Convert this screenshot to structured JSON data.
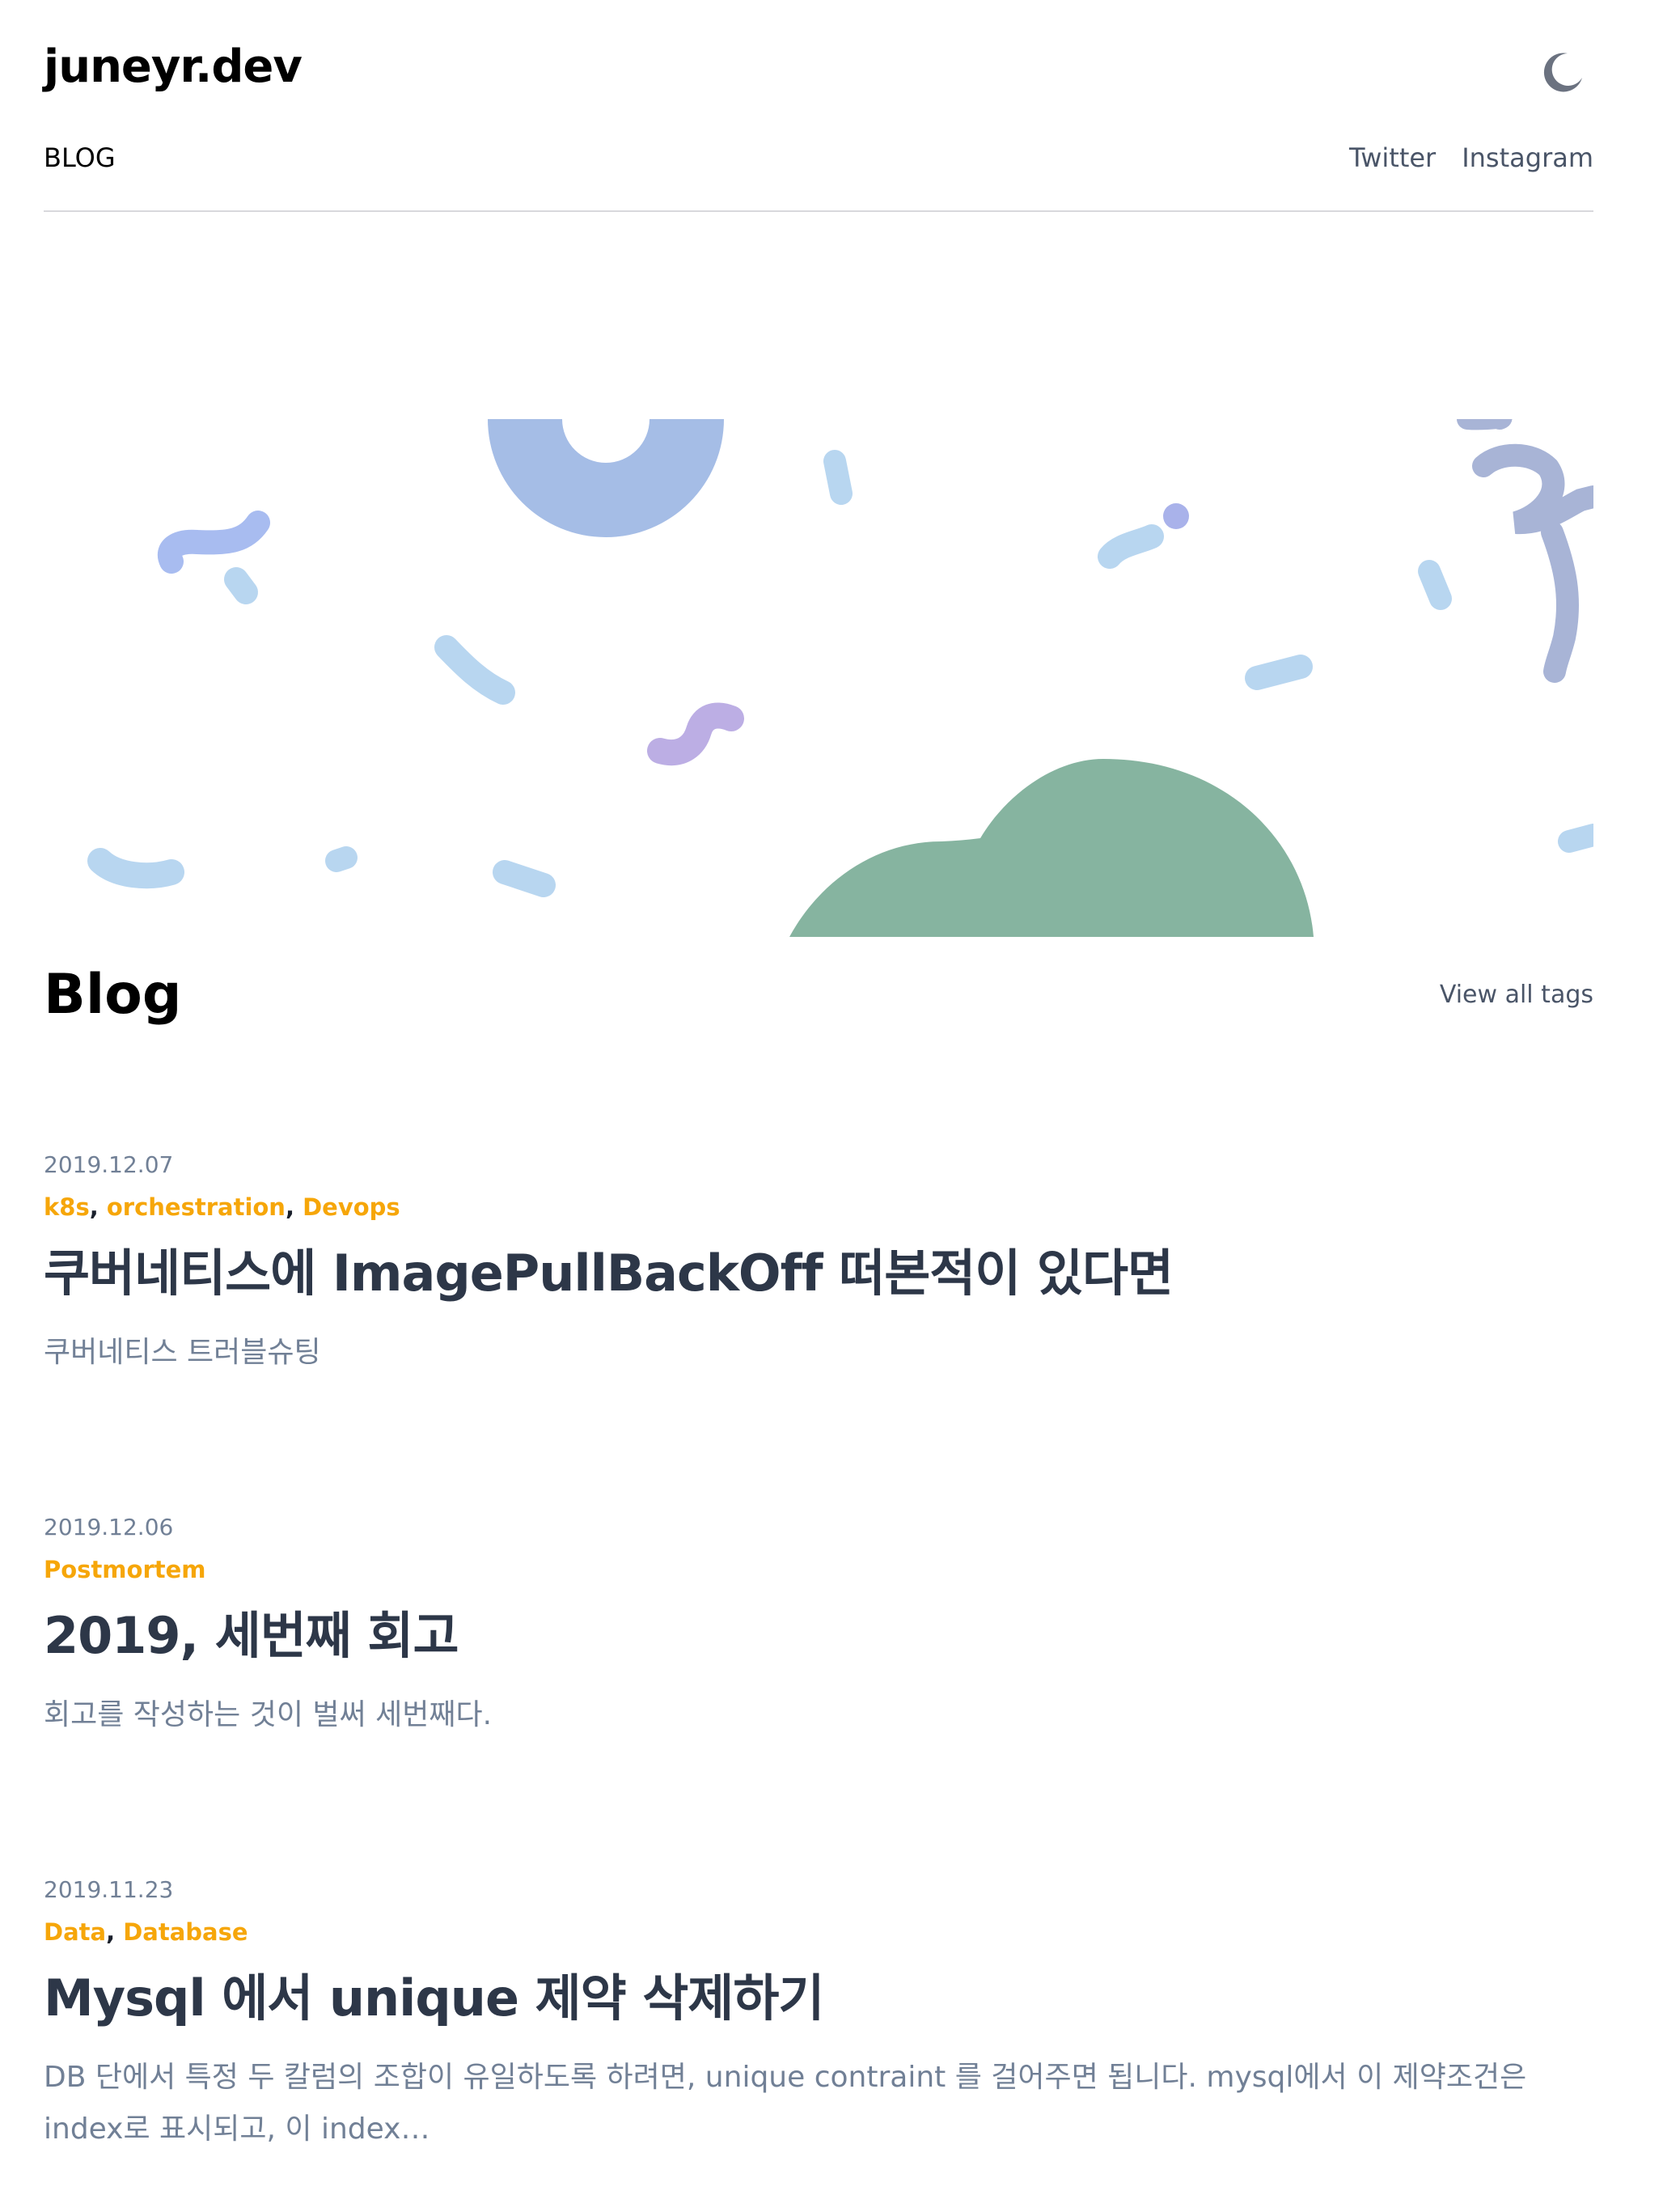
{
  "header": {
    "site_title": "juneyr.dev",
    "theme_icon": "moon-icon"
  },
  "nav": {
    "blog": "BLOG",
    "twitter": "Twitter",
    "instagram": "Instagram"
  },
  "colors": {
    "tag": "#f6a609",
    "title": "#2d3748",
    "muted": "#718096",
    "hill": "#86b4a0",
    "confetti_blue": "#b8d6f0",
    "confetti_indigo": "#a5b8e8",
    "confetti_purple": "#bcaee4"
  },
  "section": {
    "title": "Blog",
    "view_all_tags": "View all tags"
  },
  "posts": [
    {
      "date": "2019.12.07",
      "tags": [
        "k8s",
        "orchestration",
        "Devops"
      ],
      "title": "쿠버네티스에 ImagePullBackOff 떠본적이 있다면",
      "description": "쿠버네티스 트러블슈팅"
    },
    {
      "date": "2019.12.06",
      "tags": [
        "Postmortem"
      ],
      "title": "2019, 세번째 회고",
      "description": "회고를 작성하는 것이 벌써 세번째다."
    },
    {
      "date": "2019.11.23",
      "tags": [
        "Data",
        "Database"
      ],
      "title": "Mysql 에서 unique 제약 삭제하기",
      "description": "DB 단에서 특정 두 칼럼의 조합이 유일하도록 하려면, unique contraint 를 걸어주면 됩니다. mysql에서 이 제약조건은 index로 표시되고, 이 index…"
    }
  ]
}
